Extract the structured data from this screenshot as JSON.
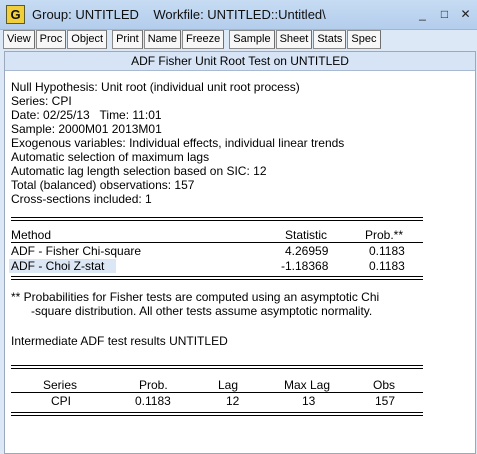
{
  "window": {
    "app_icon_letter": "G",
    "title": "Group: UNTITLED    Workfile: UNTITLED::Untitled\\",
    "minimize": "_",
    "maximize": "□",
    "close": "✕"
  },
  "toolbar": {
    "group1": [
      "View",
      "Proc",
      "Object"
    ],
    "group2": [
      "Print",
      "Name",
      "Freeze"
    ],
    "group3": [
      "Sample",
      "Sheet",
      "Stats",
      "Spec"
    ]
  },
  "output": {
    "header": "ADF Fisher Unit Root Test on UNTITLED",
    "info_lines": [
      "Null Hypothesis: Unit root (individual unit root process)",
      "Series: CPI",
      "Date: 02/25/13   Time: 11:01",
      "Sample: 2000M01 2013M01",
      "Exogenous variables: Individual effects, individual linear trends",
      "Automatic selection of maximum lags",
      "Automatic lag length selection based on SIC: 12",
      "Total (balanced) observations: 157",
      "Cross-sections included: 1"
    ],
    "method_table": {
      "headers": [
        "Method",
        "Statistic",
        "Prob.**"
      ],
      "rows": [
        [
          "ADF - Fisher Chi-square",
          "4.26959",
          "0.1183"
        ],
        [
          "ADF - Choi Z-stat",
          "-1.18368",
          "0.1183"
        ]
      ]
    },
    "footnote_line1": "** Probabilities for Fisher tests are computed using an asymptotic Chi",
    "footnote_line2": "      -square distribution. All other tests assume asymptotic normality.",
    "intermediate_title": "Intermediate ADF test results UNTITLED",
    "intermediate_table": {
      "headers": [
        "Series",
        "Prob.",
        "Lag",
        "Max Lag",
        "Obs"
      ],
      "rows": [
        [
          "CPI",
          "0.1183",
          "12",
          "13",
          "157"
        ]
      ]
    }
  }
}
